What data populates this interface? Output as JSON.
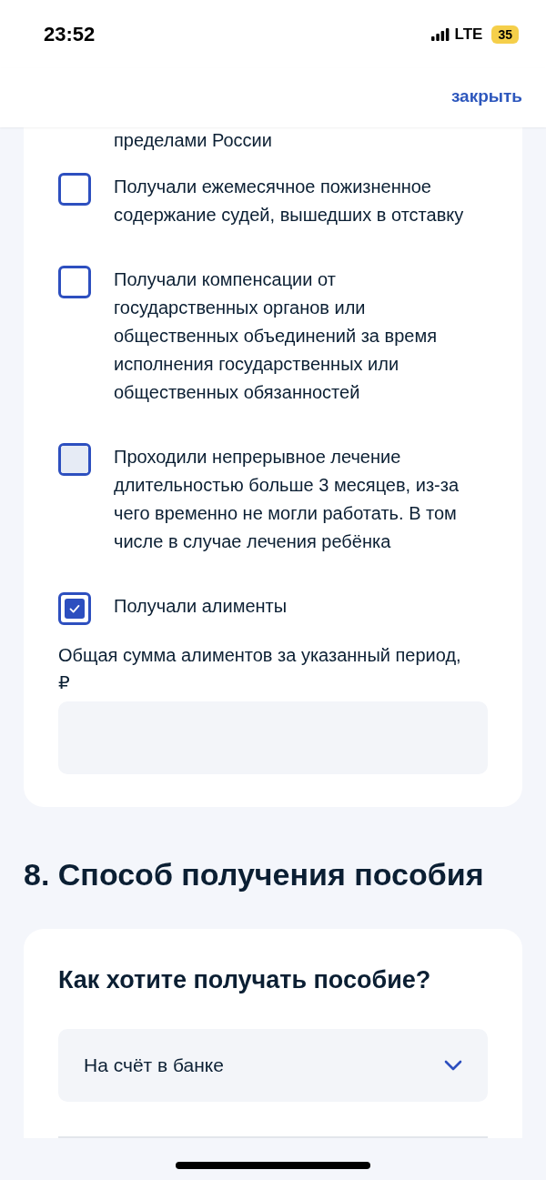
{
  "status_bar": {
    "time": "23:52",
    "network": "LTE",
    "battery": "35"
  },
  "header": {
    "close_link": "закрыть"
  },
  "form_card": {
    "cut_text": "пределами России",
    "options": [
      {
        "label": "Получали ежемесячное пожизненное содержание судей, вышедших в отставку",
        "checked": false,
        "pressed": false
      },
      {
        "label": "Получали компенсации от государственных органов или общественных объединений за время исполнения государственных или общественных обязанностей",
        "checked": false,
        "pressed": false
      },
      {
        "label": "Проходили непрерывное лечение длительностью больше 3 месяцев, из-за чего временно не могли работать. В том числе в случае лечения ребёнка",
        "checked": false,
        "pressed": true
      },
      {
        "label": "Получали алименты",
        "checked": true,
        "pressed": false
      }
    ],
    "amount_field": {
      "label": "Общая сумма алиментов за указанный период, ₽"
    }
  },
  "section": {
    "title": "8. Способ получения пособия",
    "question": "Как хотите получать пособие?",
    "select": {
      "value": "На счёт в банке"
    }
  }
}
